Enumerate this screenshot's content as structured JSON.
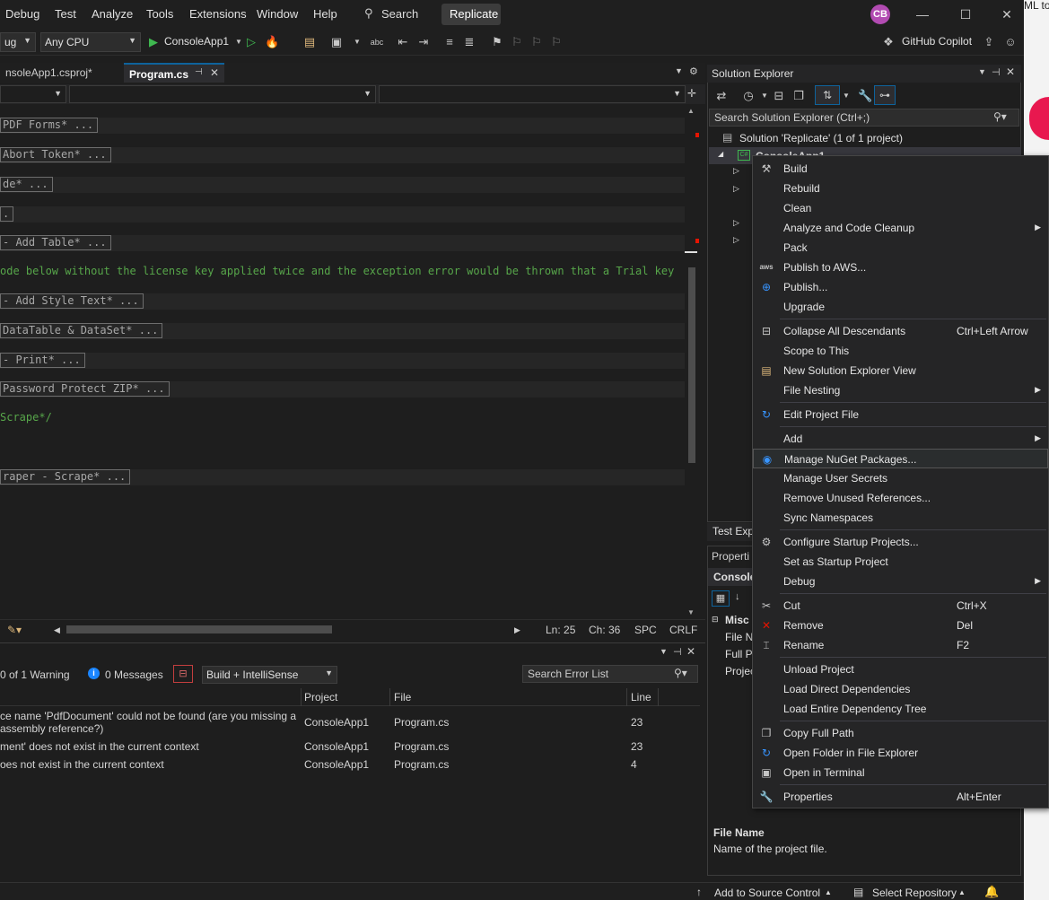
{
  "menubar": {
    "items": [
      "Debug",
      "Test",
      "Analyze",
      "Tools",
      "Extensions",
      "Window",
      "Help"
    ],
    "search_label": "Search",
    "solution_badge": "Replicate",
    "avatar_initials": "CB",
    "right_edge_text": "ML to"
  },
  "toolbar": {
    "config_combo": "ug",
    "platform_combo": "Any CPU",
    "run_target": "ConsoleApp1",
    "copilot_label": "GitHub Copilot"
  },
  "doc_tabs": {
    "tab1": "nsoleApp1.csproj*",
    "tab2": "Program.cs"
  },
  "editor": {
    "lines": [
      {
        "text": " PDF Forms* ...",
        "kind": "region"
      },
      {
        "text": " Abort Token* ...",
        "kind": "region"
      },
      {
        "text": "de* ...",
        "kind": "region"
      },
      {
        "text": ".",
        "kind": "region"
      },
      {
        "text": "- Add Table* ...",
        "kind": "region"
      },
      {
        "text": "ode below without the license key applied twice and the exception error would be thrown that a Trial key",
        "kind": "comment"
      },
      {
        "text": "- Add Style Text* ...",
        "kind": "region"
      },
      {
        "text": "DataTable & DataSet* ...",
        "kind": "region"
      },
      {
        "text": " - Print* ...",
        "kind": "region"
      },
      {
        "text": " Password Protect ZIP* ...",
        "kind": "region"
      },
      {
        "text": "Scrape*/",
        "kind": "comment"
      },
      {
        "text": "raper - Scrape* ...",
        "kind": "region"
      }
    ]
  },
  "editor_status": {
    "line": "Ln: 25",
    "col": "Ch: 36",
    "spc": "SPC",
    "crlf": "CRLF"
  },
  "errorlist": {
    "warnings": "0 of 1 Warning",
    "messages": "0 Messages",
    "scope": "Build + IntelliSense",
    "search_placeholder": "Search Error List",
    "headers": {
      "project": "Project",
      "file": "File",
      "line": "Line"
    },
    "rows": [
      {
        "desc1": "ce name 'PdfDocument' could not be found (are you missing a",
        "desc2": "assembly reference?)",
        "project": "ConsoleApp1",
        "file": "Program.cs",
        "line": "23"
      },
      {
        "desc1": "ment' does not exist in the current context",
        "desc2": "",
        "project": "ConsoleApp1",
        "file": "Program.cs",
        "line": "23"
      },
      {
        "desc1": "oes not exist in the current context",
        "desc2": "",
        "project": "ConsoleApp1",
        "file": "Program.cs",
        "line": "4"
      }
    ]
  },
  "statusbar": {
    "source_control": "Add to Source Control",
    "repository": "Select Repository"
  },
  "solution_explorer": {
    "title": "Solution Explorer",
    "search_placeholder": "Search Solution Explorer (Ctrl+;)",
    "solution_node": "Solution 'Replicate' (1 of 1 project)",
    "project_node": "ConsoleApp1",
    "test_explorer_tab": "Test Expl"
  },
  "properties": {
    "title": "Properti",
    "object": "Console",
    "category": "Misc",
    "rows": [
      "File N",
      "Full P",
      "Projec"
    ],
    "desc_title": "File Name",
    "desc_text": "Name of the project file."
  },
  "context_menu": {
    "items": [
      {
        "label": "Build",
        "icon": "build-icon",
        "shortcut": "",
        "sub": false
      },
      {
        "label": "Rebuild",
        "icon": "",
        "shortcut": "",
        "sub": false
      },
      {
        "label": "Clean",
        "icon": "",
        "shortcut": "",
        "sub": false
      },
      {
        "label": "Analyze and Code Cleanup",
        "icon": "",
        "shortcut": "",
        "sub": true
      },
      {
        "label": "Pack",
        "icon": "",
        "shortcut": "",
        "sub": false
      },
      {
        "label": "Publish to AWS...",
        "icon": "aws-icon",
        "shortcut": "",
        "sub": false
      },
      {
        "label": "Publish...",
        "icon": "globe-icon",
        "shortcut": "",
        "sub": false
      },
      {
        "label": "Upgrade",
        "icon": "",
        "shortcut": "",
        "sub": false
      },
      {
        "label": "Collapse All Descendants",
        "icon": "collapse-icon",
        "shortcut": "Ctrl+Left Arrow",
        "sub": false
      },
      {
        "label": "Scope to This",
        "icon": "",
        "shortcut": "",
        "sub": false
      },
      {
        "label": "New Solution Explorer View",
        "icon": "new-view-icon",
        "shortcut": "",
        "sub": false
      },
      {
        "label": "File Nesting",
        "icon": "",
        "shortcut": "",
        "sub": true
      },
      {
        "label": "Edit Project File",
        "icon": "edit-icon",
        "shortcut": "",
        "sub": false
      },
      {
        "label": "Add",
        "icon": "",
        "shortcut": "",
        "sub": true
      },
      {
        "label": "Manage NuGet Packages...",
        "icon": "nuget-icon",
        "shortcut": "",
        "sub": false
      },
      {
        "label": "Manage User Secrets",
        "icon": "",
        "shortcut": "",
        "sub": false
      },
      {
        "label": "Remove Unused References...",
        "icon": "",
        "shortcut": "",
        "sub": false
      },
      {
        "label": "Sync Namespaces",
        "icon": "",
        "shortcut": "",
        "sub": false
      },
      {
        "label": "Configure Startup Projects...",
        "icon": "gear-icon",
        "shortcut": "",
        "sub": false
      },
      {
        "label": "Set as Startup Project",
        "icon": "",
        "shortcut": "",
        "sub": false
      },
      {
        "label": "Debug",
        "icon": "",
        "shortcut": "",
        "sub": true
      },
      {
        "label": "Cut",
        "icon": "cut-icon",
        "shortcut": "Ctrl+X",
        "sub": false
      },
      {
        "label": "Remove",
        "icon": "remove-icon",
        "shortcut": "Del",
        "sub": false
      },
      {
        "label": "Rename",
        "icon": "rename-icon",
        "shortcut": "F2",
        "sub": false
      },
      {
        "label": "Unload Project",
        "icon": "",
        "shortcut": "",
        "sub": false
      },
      {
        "label": "Load Direct Dependencies",
        "icon": "",
        "shortcut": "",
        "sub": false
      },
      {
        "label": "Load Entire Dependency Tree",
        "icon": "",
        "shortcut": "",
        "sub": false
      },
      {
        "label": "Copy Full Path",
        "icon": "copy-icon",
        "shortcut": "",
        "sub": false
      },
      {
        "label": "Open Folder in File Explorer",
        "icon": "folder-open-icon",
        "shortcut": "",
        "sub": false
      },
      {
        "label": "Open in Terminal",
        "icon": "terminal-icon",
        "shortcut": "",
        "sub": false
      },
      {
        "label": "Properties",
        "icon": "wrench-icon",
        "shortcut": "Alt+Enter",
        "sub": false
      }
    ]
  },
  "colors": {
    "background": "#1e1e1e",
    "accent": "#0e639c",
    "comment": "#57a64a",
    "error": "#e51400",
    "avatar": "#b24bb2"
  }
}
